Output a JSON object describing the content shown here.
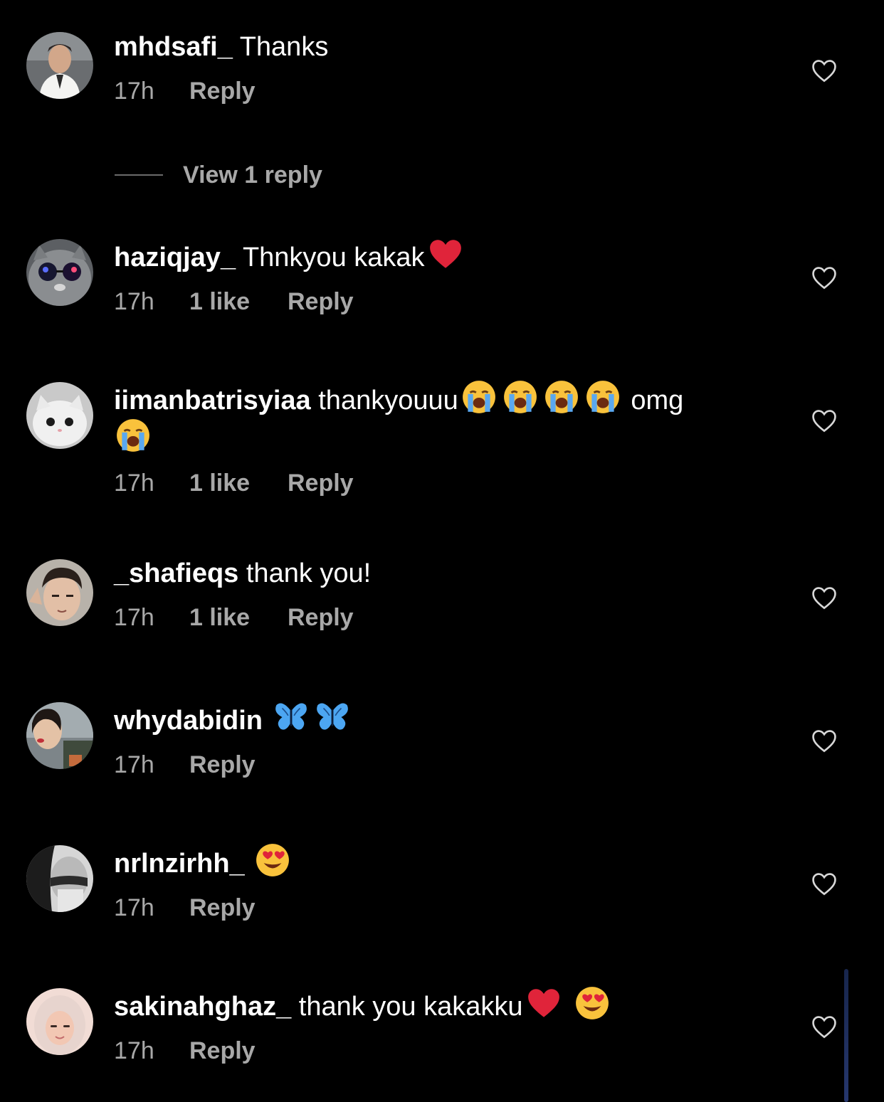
{
  "colors": {
    "background": "#000000",
    "text_primary": "#ffffff",
    "text_secondary": "#a8a8a8",
    "emoji_heart": "#e0243a"
  },
  "comments": [
    {
      "username": "mhdsafi_",
      "text": "Thanks",
      "time": "17h",
      "likes": "",
      "reply_label": "Reply",
      "emojis": []
    },
    {
      "username": "haziqjay_",
      "text": "Thnkyou kakak",
      "time": "17h",
      "likes": "1 like",
      "reply_label": "Reply",
      "emojis": [
        "red-heart"
      ]
    },
    {
      "username": "iimanbatrisyiaa",
      "text": "thankyouuu",
      "text_after": "omg",
      "time": "17h",
      "likes": "1 like",
      "reply_label": "Reply",
      "emojis": [
        "loudly-crying-face",
        "loudly-crying-face",
        "loudly-crying-face",
        "loudly-crying-face",
        "loudly-crying-face"
      ]
    },
    {
      "username": "_shafieqs",
      "text": "thank you!",
      "time": "17h",
      "likes": "1 like",
      "reply_label": "Reply",
      "emojis": []
    },
    {
      "username": "whydabidin",
      "text": "",
      "time": "17h",
      "likes": "",
      "reply_label": "Reply",
      "emojis": [
        "blue-butterfly",
        "blue-butterfly"
      ]
    },
    {
      "username": "nrlnzirhh_",
      "text": "",
      "time": "17h",
      "likes": "",
      "reply_label": "Reply",
      "emojis": [
        "heart-eyes-face"
      ]
    },
    {
      "username": "sakinahghaz_",
      "text": "thank you kakakku",
      "time": "17h",
      "likes": "",
      "reply_label": "Reply",
      "emojis": [
        "red-heart",
        "heart-eyes-face"
      ]
    }
  ],
  "view_replies": {
    "label": "View 1 reply"
  },
  "icons": {
    "like": "heart-outline-icon"
  }
}
